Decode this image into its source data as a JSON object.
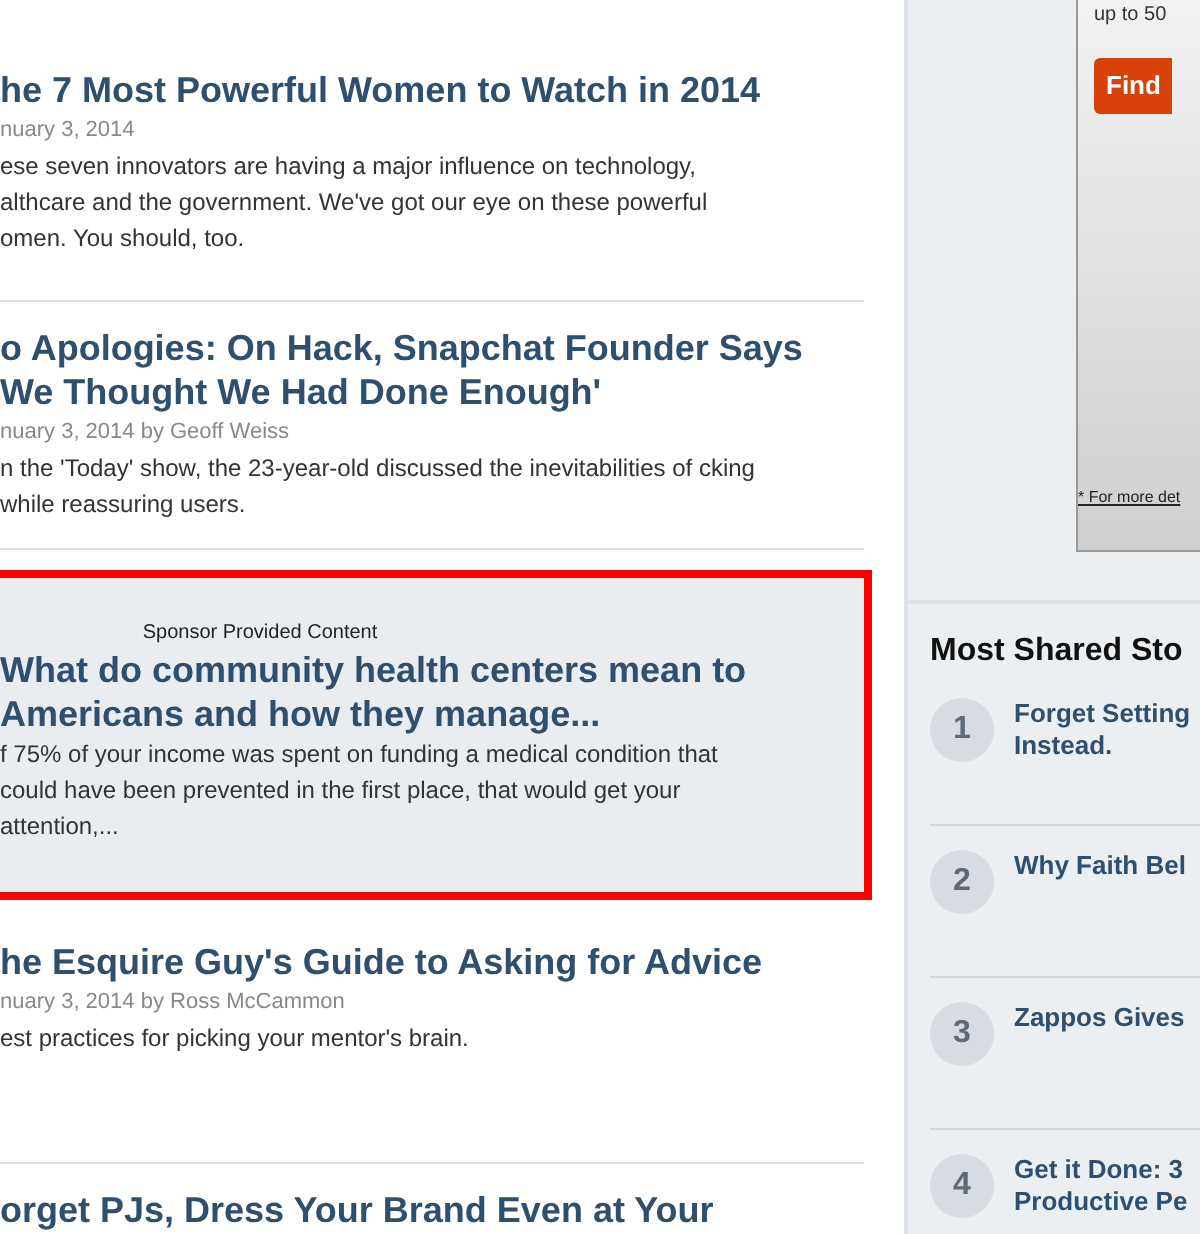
{
  "articles": [
    {
      "kind": "story",
      "title": "he 7 Most Powerful Women to Watch in 2014",
      "meta": "nuary 3, 2014",
      "summary": "ese seven innovators are having a major influence on technology, althcare and the government. We've got our eye on these powerful omen. You should, too."
    },
    {
      "kind": "story",
      "title": "o Apologies: On Hack, Snapchat Founder Says We Thought We Had Done Enough'",
      "meta": "nuary 3, 2014 by Geoff Weiss",
      "summary": "n the 'Today' show, the 23-year-old discussed the inevitabilities of cking while reassuring users."
    },
    {
      "kind": "sponsored",
      "label": "Sponsor Provided Content",
      "title": "What do community health centers mean to Americans and how they manage...",
      "summary": "f 75% of your income was spent on funding a medical condition that could have been prevented in the first place, that would get your attention,..."
    },
    {
      "kind": "story",
      "title": "he Esquire Guy's Guide to Asking for Advice",
      "meta": "nuary 3, 2014 by Ross McCammon",
      "summary": "est practices for picking your mentor's brain."
    },
    {
      "kind": "story",
      "title": "orget PJs, Dress Your Brand Even at Your"
    }
  ],
  "ad": {
    "text": "up to 50",
    "button": "Find",
    "footnote": "* For more det"
  },
  "most_shared": {
    "title": "Most Shared Sto",
    "items": [
      {
        "number": "1",
        "title": "Forget Setting Instead."
      },
      {
        "number": "2",
        "title": "Why Faith Bel"
      },
      {
        "number": "3",
        "title": "Zappos Gives"
      },
      {
        "number": "4",
        "title": "Get it Done: 3 Productive Pe"
      }
    ]
  }
}
